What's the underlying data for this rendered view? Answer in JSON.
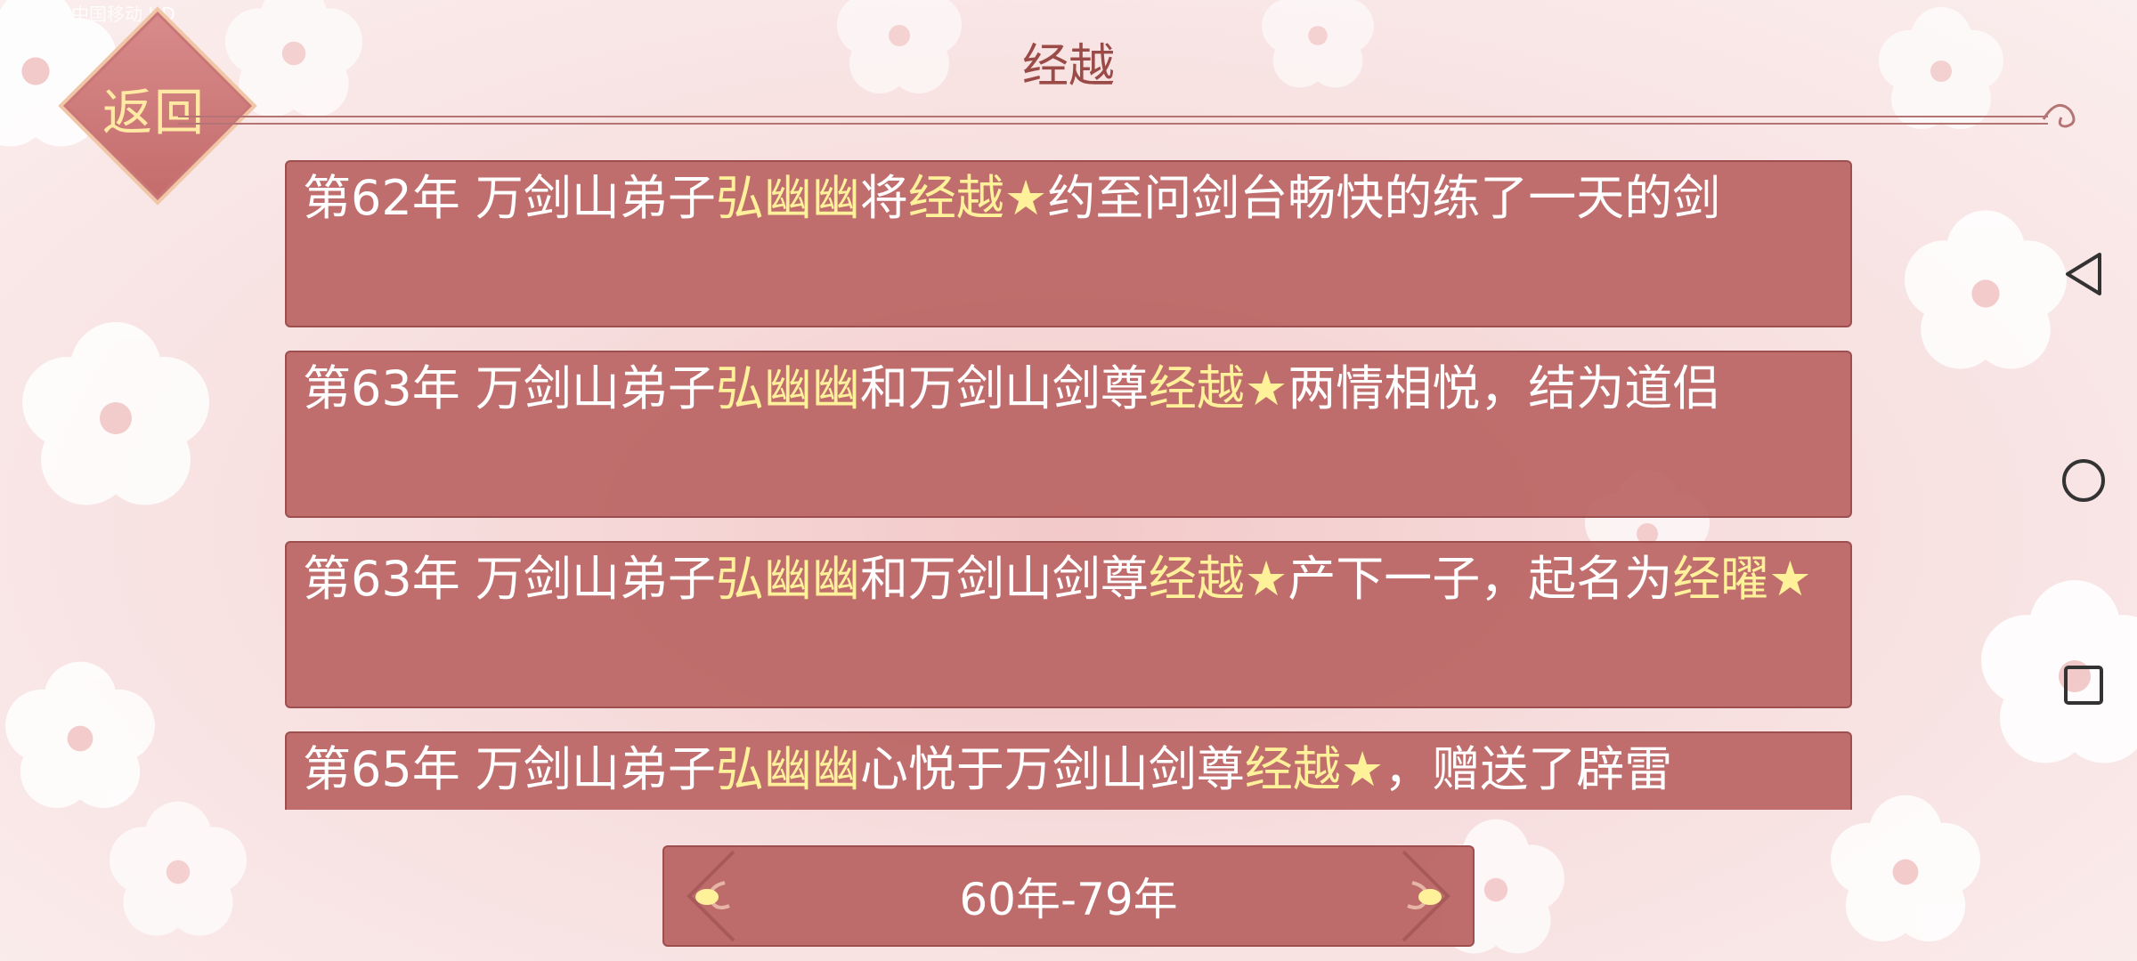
{
  "status_bar": {
    "carrier": "中国移动 HD",
    "right_text": ""
  },
  "header": {
    "back_label": "返回",
    "title": "经越"
  },
  "events": [
    {
      "segments": [
        {
          "text": "第62年 万剑山弟子",
          "hl": false
        },
        {
          "text": "弘幽幽",
          "hl": true
        },
        {
          "text": "将",
          "hl": false
        },
        {
          "text": "经越★",
          "hl": true
        },
        {
          "text": "约至问剑台畅快的练了一天的剑",
          "hl": false
        }
      ]
    },
    {
      "segments": [
        {
          "text": "第63年 万剑山弟子",
          "hl": false
        },
        {
          "text": "弘幽幽",
          "hl": true
        },
        {
          "text": "和万剑山剑尊",
          "hl": false
        },
        {
          "text": "经越★",
          "hl": true
        },
        {
          "text": "两情相悦，结为道侣",
          "hl": false
        }
      ]
    },
    {
      "segments": [
        {
          "text": "第63年 万剑山弟子",
          "hl": false
        },
        {
          "text": "弘幽幽",
          "hl": true
        },
        {
          "text": "和万剑山剑尊",
          "hl": false
        },
        {
          "text": "经越★",
          "hl": true
        },
        {
          "text": "产下一子，起名为",
          "hl": false
        },
        {
          "text": "经曜★",
          "hl": true
        }
      ]
    },
    {
      "segments": [
        {
          "text": "第65年 万剑山弟子",
          "hl": false
        },
        {
          "text": "弘幽幽",
          "hl": true
        },
        {
          "text": "心悦于万剑山剑尊",
          "hl": false
        },
        {
          "text": "经越★",
          "hl": true
        },
        {
          "text": "，赠送了辟雷",
          "hl": false
        }
      ]
    }
  ],
  "footer": {
    "range_label": "60年-79年"
  },
  "system_nav": {
    "back_icon": "triangle-back-icon",
    "home_icon": "circle-home-icon",
    "recents_icon": "square-recents-icon"
  },
  "colors": {
    "card_bg": "#ba6564",
    "highlight": "#fff09a",
    "title": "#9a4b48"
  }
}
